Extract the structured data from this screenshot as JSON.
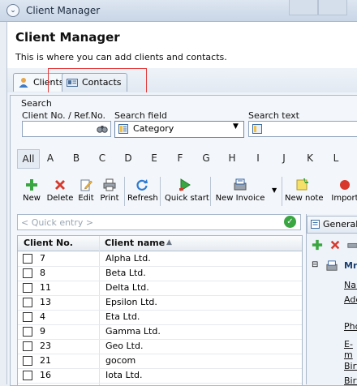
{
  "window": {
    "title": "Client Manager"
  },
  "header": {
    "title": "Client Manager",
    "subtitle": "This is where you can add clients and contacts."
  },
  "tabs": [
    {
      "label": "Clients",
      "icon": "person-icon",
      "active": true
    },
    {
      "label": "Contacts",
      "icon": "address-card-icon",
      "active": false
    }
  ],
  "search": {
    "section_label": "Search",
    "client_no_label": "Client No. / Ref.No.",
    "client_no_value": "",
    "search_field_label": "Search field",
    "search_field_value": "Category",
    "search_text_label": "Search text"
  },
  "letters": [
    "All",
    "A",
    "B",
    "C",
    "D",
    "E",
    "F",
    "G",
    "H",
    "I",
    "J",
    "K",
    "L"
  ],
  "toolbar": {
    "new": "New",
    "delete": "Delete",
    "edit": "Edit",
    "print": "Print",
    "refresh": "Refresh",
    "quick_start": "Quick start",
    "new_invoice": "New Invoice",
    "new_note": "New note",
    "import": "Import"
  },
  "quick_entry": {
    "placeholder": "< Quick entry >"
  },
  "grid": {
    "columns": [
      "Client No.",
      "Client name"
    ],
    "rows": [
      {
        "no": "7",
        "name": "Alpha Ltd."
      },
      {
        "no": "8",
        "name": "Beta Ltd."
      },
      {
        "no": "11",
        "name": "Delta Ltd."
      },
      {
        "no": "13",
        "name": "Epsilon Ltd."
      },
      {
        "no": "4",
        "name": "Eta Ltd."
      },
      {
        "no": "9",
        "name": "Gamma Ltd."
      },
      {
        "no": "23",
        "name": "Geo Ltd."
      },
      {
        "no": "21",
        "name": "gocom"
      },
      {
        "no": "16",
        "name": "Iota Ltd."
      }
    ]
  },
  "right_panel": {
    "tab": "General",
    "heading": "Mr",
    "fields": [
      "Nan",
      "Add",
      "Pho",
      "E-m",
      "Birt",
      "Birt"
    ]
  },
  "colors": {
    "accent": "#3a6ea5",
    "highlight_box": "#e23b3b",
    "ok_green": "#3aa641"
  }
}
